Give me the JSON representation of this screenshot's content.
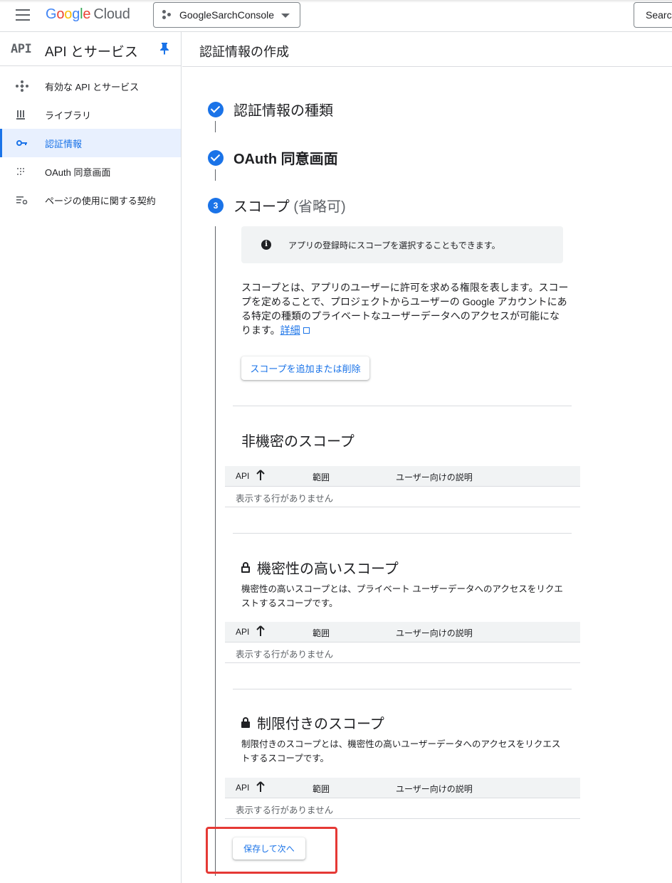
{
  "topbar": {
    "logo_google": [
      "G",
      "o",
      "o",
      "g",
      "l",
      "e"
    ],
    "logo_cloud": "Cloud",
    "project_name": "GoogleSarchConsole",
    "search_label": "Search"
  },
  "sidebar": {
    "api_mark": "API",
    "title": "API とサービス",
    "items": [
      {
        "label": "有効な API とサービス"
      },
      {
        "label": "ライブラリ"
      },
      {
        "label": "認証情報"
      },
      {
        "label": "OAuth 同意画面"
      },
      {
        "label": "ページの使用に関する契約"
      }
    ]
  },
  "page": {
    "title": "認証情報の作成"
  },
  "steps": [
    {
      "label": "認証情報の種類"
    },
    {
      "label": "OAuth 同意画面"
    },
    {
      "number": "3",
      "label": "スコープ",
      "optional": "(省略可)"
    }
  ],
  "info": {
    "text": "アプリの登録時にスコープを選択することもできます。"
  },
  "description": {
    "text": "スコープとは、アプリのユーザーに許可を求める権限を表します。スコープを定めることで、プロジェクトからユーザーの Google アカウントにある特定の種類のプライベートなユーザーデータへのアクセスが可能になります。",
    "link": "詳細"
  },
  "scope_button": "スコープを追加または削除",
  "sections": [
    {
      "title": "非機密のスコープ",
      "description": "",
      "headers": [
        "API",
        "範囲",
        "ユーザー向けの説明"
      ],
      "empty": "表示する行がありません"
    },
    {
      "title": "機密性の高いスコープ",
      "description": "機密性の高いスコープとは、プライベート ユーザーデータへのアクセスをリクエストするスコープです。",
      "headers": [
        "API",
        "範囲",
        "ユーザー向けの説明"
      ],
      "empty": "表示する行がありません"
    },
    {
      "title": "制限付きのスコープ",
      "description": "制限付きのスコープとは、機密性の高いユーザーデータへのアクセスをリクエストするスコープです。",
      "headers": [
        "API",
        "範囲",
        "ユーザー向けの説明"
      ],
      "empty": "表示する行がありません"
    }
  ],
  "save_button": "保存して次へ",
  "colors": {
    "accent": "#1a73e8",
    "highlight": "#e53935",
    "active_bg": "#e8f0fe"
  }
}
